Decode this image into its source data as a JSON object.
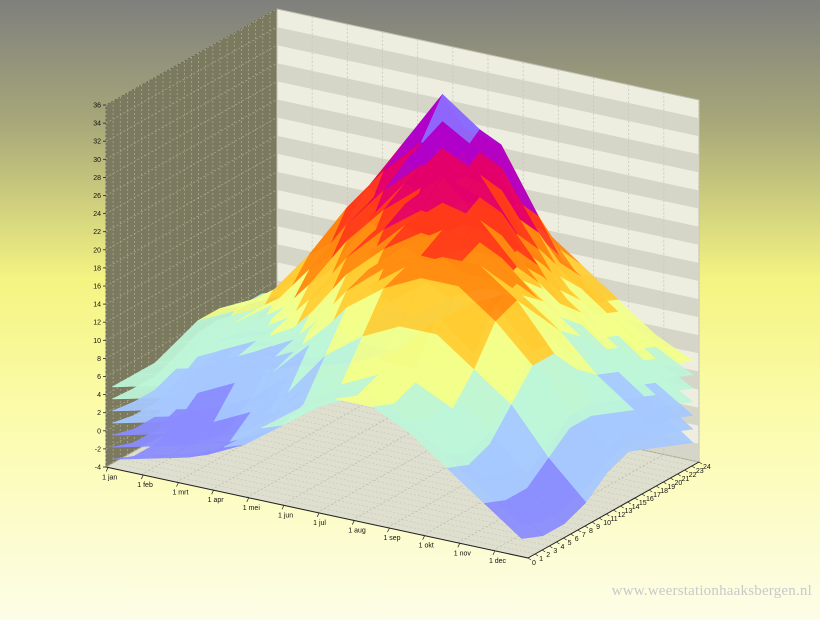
{
  "watermark": "www.weerstationhaaksbergen.nl",
  "chart_data": {
    "type": "surface3d",
    "title": "",
    "xlabel": "",
    "ylabel": "",
    "zlabel": "",
    "x_tick_labels": [
      "1 jan",
      "1 feb",
      "1 mrt",
      "1 apr",
      "1 mei",
      "1 jun",
      "1 jul",
      "1 aug",
      "1 sep",
      "1 okt",
      "1 nov",
      "1 dec"
    ],
    "y_tick_labels": [
      "0",
      "1",
      "2",
      "3",
      "4",
      "5",
      "6",
      "7",
      "8",
      "9",
      "10",
      "11",
      "12",
      "13",
      "14",
      "15",
      "16",
      "17",
      "18",
      "19",
      "20",
      "21",
      "22",
      "23",
      "24"
    ],
    "z_tick_labels": [
      "-4",
      "-2",
      "0",
      "2",
      "4",
      "6",
      "8",
      "10",
      "12",
      "14",
      "16",
      "18",
      "20",
      "22",
      "24",
      "26",
      "28",
      "30",
      "32",
      "34",
      "36"
    ],
    "zlim": [
      -4,
      36
    ],
    "ylim": [
      0,
      24
    ],
    "months": [
      "jan",
      "feb",
      "mrt",
      "apr",
      "mei",
      "jun",
      "jul",
      "aug",
      "sep",
      "okt",
      "nov",
      "dec"
    ],
    "hours": [
      0,
      3,
      6,
      9,
      12,
      15,
      18,
      21,
      24
    ],
    "temperature_max": [
      [
        5,
        5,
        5,
        6,
        7,
        7,
        6,
        6,
        5
      ],
      [
        6,
        6,
        6,
        7,
        9,
        9,
        8,
        7,
        6
      ],
      [
        7,
        7,
        7,
        9,
        12,
        12,
        10,
        8,
        7
      ],
      [
        10,
        9,
        10,
        14,
        17,
        17,
        15,
        12,
        10
      ],
      [
        13,
        12,
        14,
        19,
        23,
        24,
        21,
        16,
        13
      ],
      [
        15,
        14,
        17,
        23,
        28,
        30,
        27,
        20,
        16
      ],
      [
        17,
        16,
        19,
        26,
        32,
        36,
        31,
        23,
        18
      ],
      [
        17,
        16,
        18,
        25,
        31,
        33,
        30,
        22,
        18
      ],
      [
        15,
        14,
        15,
        20,
        25,
        26,
        23,
        18,
        15
      ],
      [
        12,
        11,
        12,
        15,
        19,
        19,
        16,
        13,
        12
      ],
      [
        9,
        9,
        9,
        10,
        12,
        12,
        11,
        10,
        9
      ],
      [
        7,
        7,
        7,
        7,
        8,
        8,
        8,
        8,
        7
      ]
    ],
    "temperature_min": [
      [
        -3,
        -4,
        -4,
        -3,
        -1,
        0,
        -1,
        -2,
        -3
      ],
      [
        -2,
        -3,
        -3,
        -2,
        1,
        2,
        0,
        -1,
        -2
      ],
      [
        -1,
        -2,
        -2,
        0,
        3,
        4,
        2,
        0,
        -1
      ],
      [
        1,
        0,
        0,
        3,
        7,
        8,
        5,
        3,
        1
      ],
      [
        4,
        3,
        4,
        8,
        12,
        13,
        10,
        7,
        5
      ],
      [
        7,
        6,
        7,
        11,
        15,
        16,
        13,
        10,
        8
      ],
      [
        9,
        8,
        9,
        13,
        17,
        18,
        15,
        12,
        10
      ],
      [
        9,
        8,
        9,
        13,
        17,
        18,
        15,
        12,
        10
      ],
      [
        7,
        6,
        7,
        10,
        14,
        15,
        12,
        9,
        7
      ],
      [
        4,
        3,
        4,
        7,
        10,
        10,
        7,
        5,
        4
      ],
      [
        1,
        0,
        0,
        2,
        4,
        4,
        3,
        2,
        1
      ],
      [
        -2,
        -3,
        -3,
        -2,
        0,
        1,
        0,
        -1,
        -2
      ]
    ],
    "colors": [
      "#8a8cff",
      "#a6c8ff",
      "#bdf5d8",
      "#f2ff8a",
      "#ffcc33",
      "#ff8a10",
      "#ff3a1a",
      "#e4006a",
      "#b000c8",
      "#8c6cff"
    ]
  }
}
